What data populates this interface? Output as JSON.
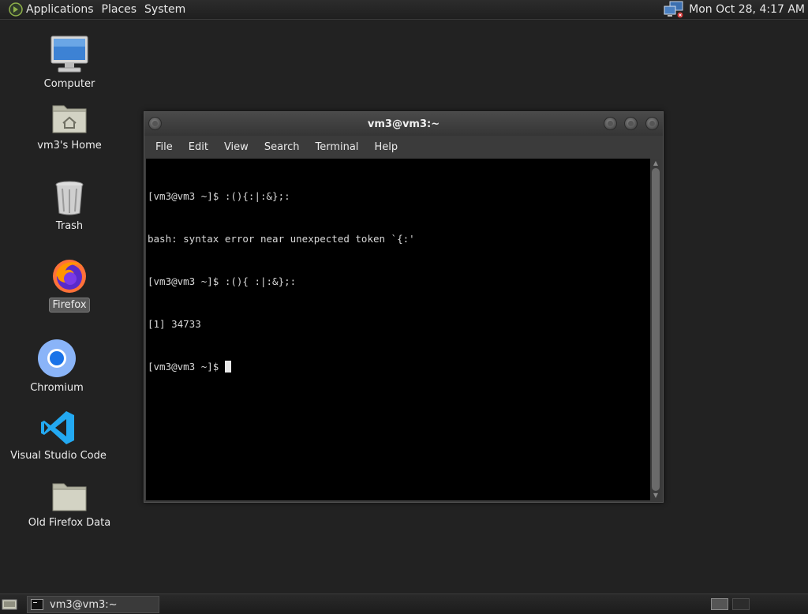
{
  "top_panel": {
    "applications": "Applications",
    "places": "Places",
    "system": "System",
    "clock": "Mon Oct 28,  4:17 AM",
    "icons": [
      "apps-icon",
      "network-icon"
    ]
  },
  "desktop": {
    "icons": [
      {
        "label": "Computer",
        "icon": "computer-icon"
      },
      {
        "label": "vm3's Home",
        "icon": "home-folder-icon"
      },
      {
        "label": "Trash",
        "icon": "trash-icon"
      },
      {
        "label": "Firefox",
        "icon": "firefox-icon",
        "selected": true
      },
      {
        "label": "Chromium",
        "icon": "chromium-icon"
      },
      {
        "label": "Visual Studio Code",
        "icon": "vscode-icon"
      },
      {
        "label": "Old Firefox Data",
        "icon": "folder-icon"
      }
    ]
  },
  "terminal": {
    "title": "vm3@vm3:~",
    "menu": [
      "File",
      "Edit",
      "View",
      "Search",
      "Terminal",
      "Help"
    ],
    "lines": [
      "[vm3@vm3 ~]$ :(){:|:&};:",
      "bash: syntax error near unexpected token `{:'",
      "[vm3@vm3 ~]$ :(){ :|:&};:",
      "[1] 34733",
      "[vm3@vm3 ~]$ "
    ]
  },
  "bottom_panel": {
    "task_label": "vm3@vm3:~"
  },
  "colors": {
    "desktop_bg": "#222222",
    "terminal_bg": "#000000",
    "chromium_blue": "#1a73e8",
    "vscode_blue": "#23a9f2"
  }
}
